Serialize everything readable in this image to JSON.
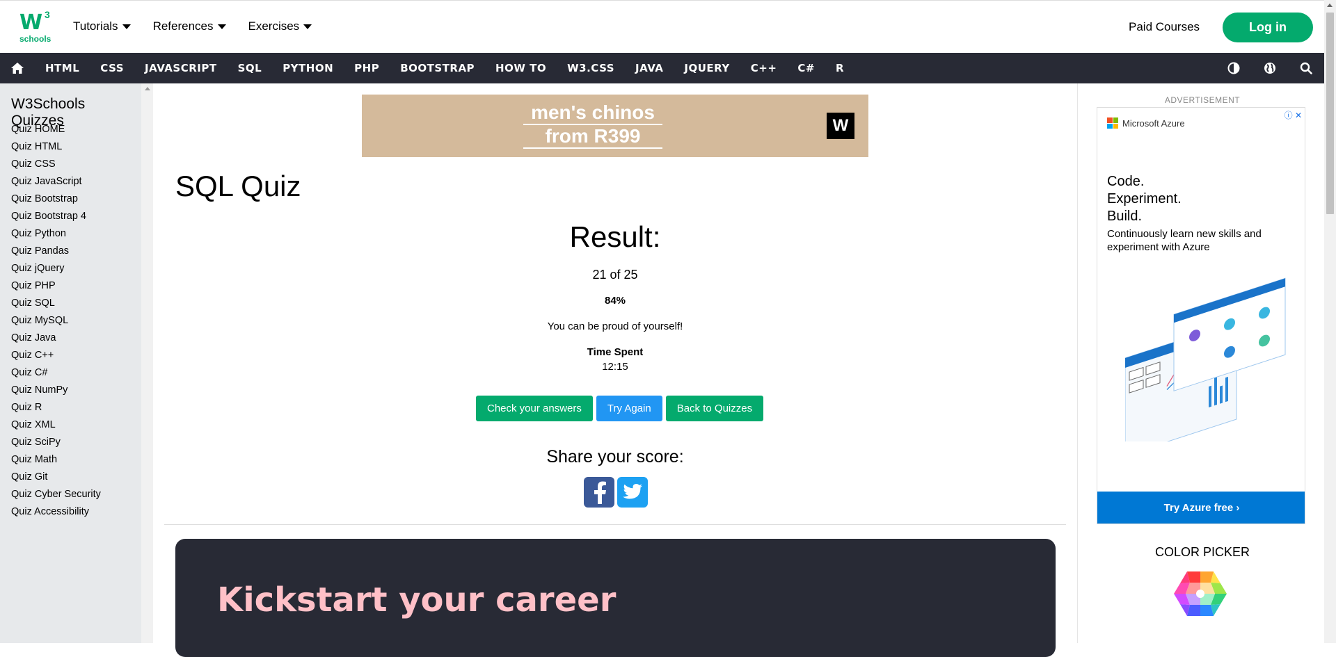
{
  "logo": {
    "text": "W",
    "sup": "3",
    "sub": "schools"
  },
  "topnav": [
    {
      "label": "Tutorials"
    },
    {
      "label": "References"
    },
    {
      "label": "Exercises"
    }
  ],
  "header": {
    "paid_courses": "Paid Courses",
    "login": "Log in"
  },
  "navbar": {
    "links": [
      "HTML",
      "CSS",
      "JAVASCRIPT",
      "SQL",
      "PYTHON",
      "PHP",
      "BOOTSTRAP",
      "HOW TO",
      "W3.CSS",
      "JAVA",
      "JQUERY",
      "C++",
      "C#",
      "R"
    ]
  },
  "sidebar": {
    "title": "W3Schools Quizzes",
    "items": [
      "Quiz HOME",
      "Quiz HTML",
      "Quiz CSS",
      "Quiz JavaScript",
      "Quiz Bootstrap",
      "Quiz Bootstrap 4",
      "Quiz Python",
      "Quiz Pandas",
      "Quiz jQuery",
      "Quiz PHP",
      "Quiz SQL",
      "Quiz MySQL",
      "Quiz Java",
      "Quiz C++",
      "Quiz C#",
      "Quiz NumPy",
      "Quiz R",
      "Quiz XML",
      "Quiz SciPy",
      "Quiz Math",
      "Quiz Git",
      "Quiz Cyber Security",
      "Quiz Accessibility"
    ]
  },
  "top_ad": {
    "line1": "men's chinos",
    "line2": "from R399",
    "badge": "W"
  },
  "main": {
    "title": "SQL Quiz",
    "result_heading": "Result:",
    "score": "21 of 25",
    "percent": "84%",
    "message": "You can be proud of yourself!",
    "time_label": "Time Spent",
    "time_value": "12:15",
    "buttons": {
      "check": "Check your answers",
      "again": "Try Again",
      "back": "Back to Quizzes"
    },
    "share_label": "Share your score:",
    "career": "Kickstart your career"
  },
  "right_ad": {
    "label": "ADVERTISEMENT",
    "brand": "Microsoft Azure",
    "head1": "Code.",
    "head2": "Experiment.",
    "head3": "Build.",
    "sub": "Continuously learn new skills and experiment with Azure",
    "cta": "Try Azure free ›"
  },
  "color_picker": {
    "label": "COLOR PICKER"
  },
  "colors": {
    "brand_green": "#04AA6D",
    "nav_dark": "#282A35",
    "blue": "#2196F3",
    "career_pink": "#FFC0C7"
  }
}
